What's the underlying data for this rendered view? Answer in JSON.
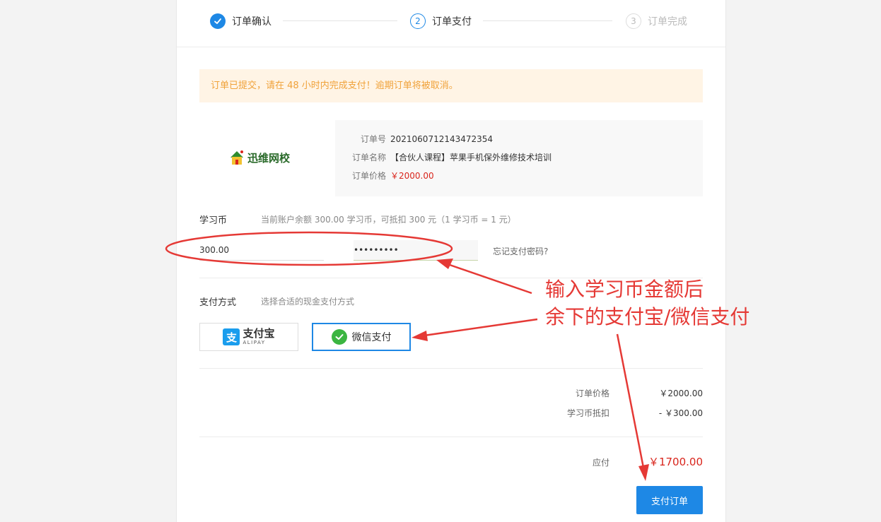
{
  "steps": [
    {
      "label": "订单确认",
      "status": "done"
    },
    {
      "number": "2",
      "label": "订单支付",
      "status": "active"
    },
    {
      "number": "3",
      "label": "订单完成",
      "status": "pending"
    }
  ],
  "notice": "订单已提交，请在 48 小时内完成支付！逾期订单将被取消。",
  "logo": {
    "text": "迅维网校"
  },
  "order": {
    "number_label": "订单号",
    "number": "2021060712143472354",
    "name_label": "订单名称",
    "name": "【合伙人课程】苹果手机保外维修技术培训",
    "price_label": "订单价格",
    "price": "￥2000.00"
  },
  "coins": {
    "title": "学习币",
    "hint": "当前账户余额 300.00 学习币，可抵扣 300 元（1 学习币 = 1 元）",
    "amount_value": "300.00",
    "password_value": "•••••••••",
    "forgot": "忘记支付密码?"
  },
  "payment": {
    "title": "支付方式",
    "hint": "选择合适的现金支付方式",
    "alipay": {
      "logo_char": "支",
      "cn": "支付宝",
      "en": "ALIPAY"
    },
    "wechat": {
      "label": "微信支付"
    },
    "selected": "wechat"
  },
  "summary": {
    "price_label": "订单价格",
    "price": "￥2000.00",
    "coin_label": "学习币抵扣",
    "coin": "- ￥300.00",
    "due_label": "应付",
    "due": "￥1700.00"
  },
  "submit_label": "支付订单",
  "annotation": {
    "line1": "输入学习币金额后",
    "line2": "余下的支付宝/微信支付"
  },
  "colors": {
    "accent": "#1e88e5",
    "price_red": "#d9251c",
    "notice_bg": "#fff4e5",
    "notice_text": "#f0a23a",
    "annotation_red": "#e53935"
  }
}
